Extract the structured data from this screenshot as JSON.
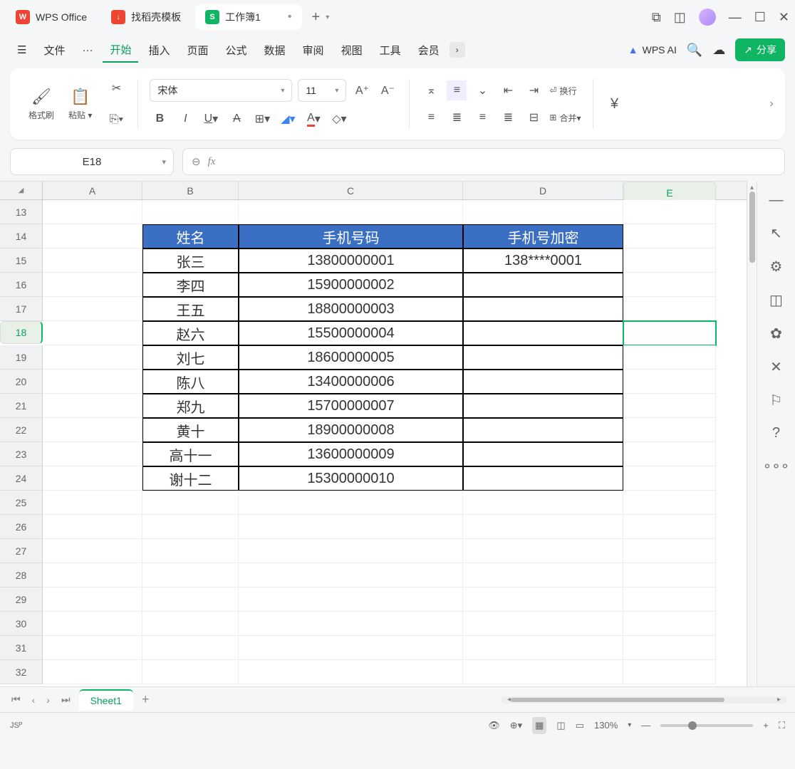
{
  "titlebar": {
    "app": "WPS Office",
    "tab2": "找稻壳模板",
    "tab3": "工作簿1"
  },
  "menu": {
    "file": "文件",
    "items": [
      "开始",
      "插入",
      "页面",
      "公式",
      "数据",
      "审阅",
      "视图",
      "工具",
      "会员"
    ],
    "wpsai": "WPS AI",
    "share": "分享"
  },
  "ribbon": {
    "format_brush": "格式刷",
    "paste": "粘贴",
    "font": "宋体",
    "size": "11",
    "wrap": "换行",
    "merge": "合并",
    "currency": "¥"
  },
  "namebox": "E18",
  "columns": [
    "A",
    "B",
    "C",
    "D",
    "E"
  ],
  "row_start": 13,
  "row_end": 32,
  "active": {
    "row": 18,
    "col": "E"
  },
  "table": {
    "headers": [
      "姓名",
      "手机号码",
      "手机号加密"
    ],
    "rows": [
      [
        "张三",
        "13800000001",
        "138****0001"
      ],
      [
        "李四",
        "15900000002",
        ""
      ],
      [
        "王五",
        "18800000003",
        ""
      ],
      [
        "赵六",
        "15500000004",
        ""
      ],
      [
        "刘七",
        "18600000005",
        ""
      ],
      [
        "陈八",
        "13400000006",
        ""
      ],
      [
        "郑九",
        "15700000007",
        ""
      ],
      [
        "黄十",
        "18900000008",
        ""
      ],
      [
        "高十一",
        "13600000009",
        ""
      ],
      [
        "谢十二",
        "15300000010",
        ""
      ]
    ]
  },
  "sheet": "Sheet1",
  "zoom": "130%"
}
